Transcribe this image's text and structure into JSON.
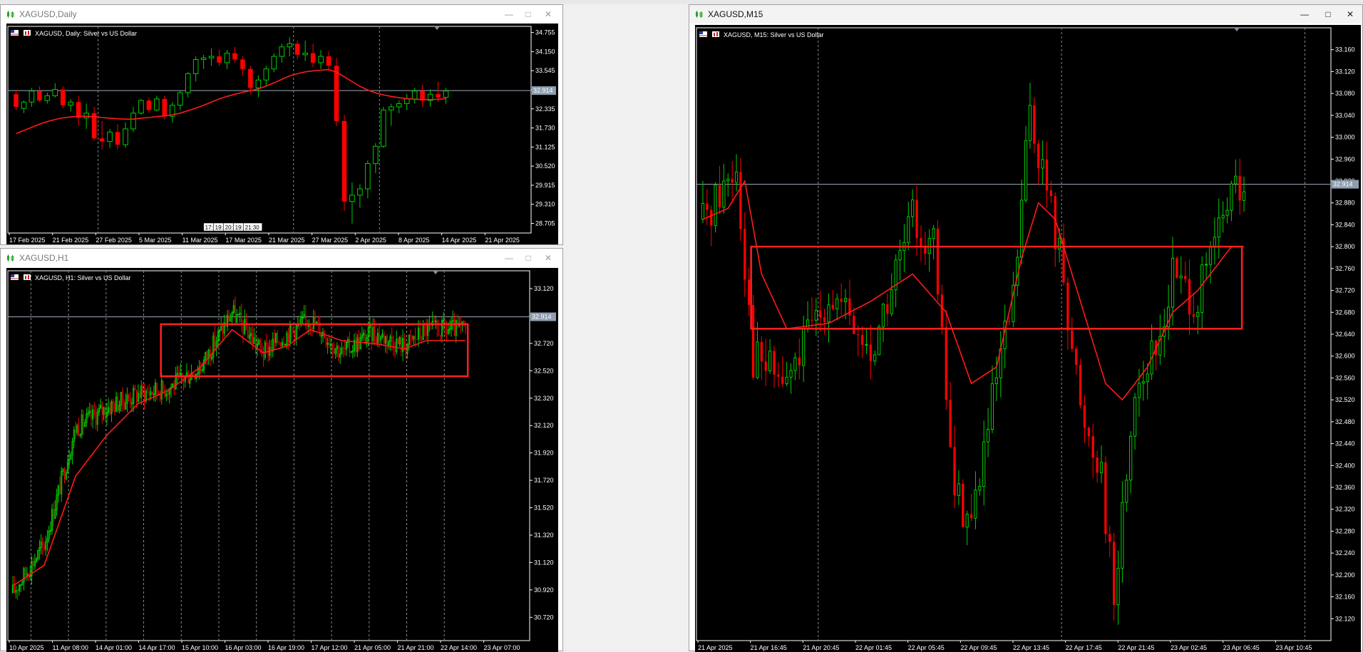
{
  "colors": {
    "bull": "#00cc00",
    "bear": "#ff0000",
    "ma": "#ff1a1a",
    "box": "#ff2020",
    "grid": "#8a8a8a",
    "axis": "#ffffff",
    "text": "#ffffff",
    "bid_line": "#a0a8b8",
    "bid_bg": "#8e9eb0",
    "label_bg": "#ffffff",
    "label_text": "#000000"
  },
  "icons": {
    "window": "candles-window-icon",
    "flag": "us-flag-icon",
    "chart": "candlestick-chart-icon",
    "minimize": "minimize-icon",
    "maximize": "maximize-icon",
    "close": "close-icon"
  },
  "windows": [
    {
      "id": "daily",
      "title": "XAGUSD,Daily",
      "header": "XAGUSD, Daily:  Silver vs US Dollar",
      "current_price": "32.914",
      "current_value": 32.914,
      "chart_data": {
        "type": "candlestick",
        "symbol": "XAGUSD",
        "timeframe": "Daily",
        "ylim": [
          28.4,
          34.95
        ],
        "y_ticks": [
          "34.755",
          "34.150",
          "33.545",
          "32.940",
          "32.335",
          "31.730",
          "31.125",
          "30.520",
          "29.915",
          "29.310",
          "28.705"
        ],
        "x_labels": [
          "17 Feb 2025",
          "21 Feb 2025",
          "27 Feb 2025",
          "5 Mar 2025",
          "11 Mar 2025",
          "17 Mar 2025",
          "21 Mar 2025",
          "27 Mar 2025",
          "2 Apr 2025",
          "8 Apr 2025",
          "14 Apr 2025",
          "21 Apr 2025"
        ],
        "x_dividers": [
          11,
          36,
          47
        ],
        "ohlc": [
          [
            32.8,
            32.95,
            32.3,
            32.4
          ],
          [
            32.35,
            32.6,
            32.2,
            32.55
          ],
          [
            32.55,
            33.0,
            32.4,
            32.9
          ],
          [
            32.9,
            33.05,
            32.55,
            32.6
          ],
          [
            32.6,
            32.85,
            32.5,
            32.75
          ],
          [
            32.75,
            33.15,
            32.7,
            32.95
          ],
          [
            32.95,
            33.05,
            32.35,
            32.45
          ],
          [
            32.45,
            32.65,
            32.25,
            32.55
          ],
          [
            32.55,
            32.75,
            31.8,
            32.05
          ],
          [
            32.05,
            32.5,
            31.7,
            32.2
          ],
          [
            32.2,
            32.4,
            31.35,
            31.4
          ],
          [
            31.4,
            31.95,
            31.05,
            31.3
          ],
          [
            31.3,
            31.7,
            31.1,
            31.6
          ],
          [
            31.6,
            31.85,
            31.05,
            31.2
          ],
          [
            31.2,
            31.9,
            31.1,
            31.7
          ],
          [
            31.7,
            32.4,
            31.6,
            32.2
          ],
          [
            32.2,
            32.65,
            32.15,
            32.6
          ],
          [
            32.6,
            32.7,
            32.2,
            32.3
          ],
          [
            32.3,
            32.75,
            32.25,
            32.65
          ],
          [
            32.65,
            32.75,
            32.0,
            32.1
          ],
          [
            32.1,
            32.55,
            31.9,
            32.45
          ],
          [
            32.45,
            32.9,
            32.3,
            32.85
          ],
          [
            32.85,
            33.5,
            32.7,
            33.45
          ],
          [
            33.45,
            34.0,
            33.2,
            33.9
          ],
          [
            33.9,
            34.05,
            33.6,
            33.95
          ],
          [
            33.95,
            34.25,
            33.7,
            34.0
          ],
          [
            34.0,
            34.2,
            33.7,
            33.8
          ],
          [
            33.8,
            34.2,
            33.6,
            34.1
          ],
          [
            34.1,
            34.3,
            33.8,
            33.9
          ],
          [
            33.9,
            34.0,
            33.4,
            33.6
          ],
          [
            33.6,
            33.7,
            32.8,
            33.0
          ],
          [
            33.0,
            33.4,
            32.7,
            33.25
          ],
          [
            33.25,
            33.7,
            33.05,
            33.6
          ],
          [
            33.6,
            34.1,
            33.5,
            34.0
          ],
          [
            34.0,
            34.4,
            33.8,
            34.3
          ],
          [
            34.3,
            34.6,
            34.0,
            34.4
          ],
          [
            34.4,
            34.5,
            33.9,
            34.05
          ],
          [
            34.05,
            34.5,
            33.85,
            34.1
          ],
          [
            34.1,
            34.4,
            33.65,
            33.8
          ],
          [
            33.8,
            34.2,
            33.6,
            34.0
          ],
          [
            34.0,
            34.15,
            33.55,
            33.7
          ],
          [
            33.7,
            33.95,
            31.8,
            31.95
          ],
          [
            31.95,
            32.15,
            29.1,
            29.4
          ],
          [
            29.4,
            30.0,
            28.7,
            29.6
          ],
          [
            29.6,
            29.95,
            29.2,
            29.8
          ],
          [
            29.8,
            30.7,
            29.5,
            30.6
          ],
          [
            30.6,
            31.25,
            30.3,
            31.15
          ],
          [
            31.15,
            32.4,
            31.1,
            32.3
          ],
          [
            32.3,
            32.5,
            31.8,
            32.4
          ],
          [
            32.4,
            32.6,
            32.2,
            32.5
          ],
          [
            32.5,
            32.8,
            32.3,
            32.65
          ],
          [
            32.65,
            33.0,
            32.5,
            32.9
          ],
          [
            32.9,
            33.1,
            32.4,
            32.6
          ],
          [
            32.6,
            32.95,
            32.4,
            32.8
          ],
          [
            32.8,
            33.2,
            32.55,
            32.7
          ],
          [
            32.7,
            33.0,
            32.5,
            32.9
          ]
        ],
        "ma": [
          31.55,
          31.65,
          31.75,
          31.85,
          31.93,
          32.0,
          32.05,
          32.08,
          32.1,
          32.1,
          32.09,
          32.06,
          32.04,
          32.02,
          32.01,
          32.01,
          32.04,
          32.06,
          32.09,
          32.11,
          32.15,
          32.2,
          32.28,
          32.36,
          32.45,
          32.55,
          32.65,
          32.73,
          32.8,
          32.86,
          32.91,
          32.97,
          33.06,
          33.16,
          33.27,
          33.38,
          33.45,
          33.51,
          33.54,
          33.56,
          33.58,
          33.5,
          33.35,
          33.2,
          33.05,
          32.93,
          32.84,
          32.78,
          32.73,
          32.69,
          32.66,
          32.64,
          32.63,
          32.63,
          32.64,
          32.66
        ],
        "overlay_labels": [
          "17:",
          "19:",
          "20:",
          "19:",
          "21:30"
        ]
      }
    },
    {
      "id": "h1",
      "title": "XAGUSD,H1",
      "header": "XAGUSD, H1:  Silver vs US Dollar",
      "current_price": "32.914",
      "current_value": 32.914,
      "chart_data": {
        "type": "candlestick",
        "symbol": "XAGUSD",
        "timeframe": "H1",
        "ylim": [
          30.55,
          33.25
        ],
        "y_ticks": [
          "33.120",
          "32.920",
          "32.720",
          "32.520",
          "32.320",
          "32.120",
          "31.920",
          "31.720",
          "31.520",
          "31.320",
          "31.120",
          "30.920",
          "30.720"
        ],
        "x_labels": [
          "10 Apr 2025",
          "11 Apr 08:00",
          "14 Apr 01:00",
          "14 Apr 17:00",
          "15 Apr 10:00",
          "16 Apr 03:00",
          "16 Apr 19:00",
          "17 Apr 12:00",
          "21 Apr 05:00",
          "21 Apr 21:00",
          "22 Apr 14:00",
          "23 Apr 07:00"
        ],
        "x_dividers": [
          12,
          36,
          60,
          84,
          108,
          132,
          156,
          180,
          204,
          228,
          252,
          276
        ],
        "trend_points": [
          [
            0,
            30.9
          ],
          [
            20,
            31.25
          ],
          [
            40,
            32.1
          ],
          [
            60,
            32.25
          ],
          [
            80,
            32.35
          ],
          [
            100,
            32.4
          ],
          [
            120,
            32.55
          ],
          [
            140,
            32.95
          ],
          [
            160,
            32.65
          ],
          [
            170,
            32.75
          ],
          [
            190,
            32.9
          ],
          [
            210,
            32.65
          ],
          [
            230,
            32.8
          ],
          [
            250,
            32.7
          ],
          [
            264,
            32.82
          ]
        ],
        "ma_points": [
          [
            0,
            30.95
          ],
          [
            20,
            31.1
          ],
          [
            40,
            31.75
          ],
          [
            60,
            32.05
          ],
          [
            80,
            32.28
          ],
          [
            100,
            32.38
          ],
          [
            120,
            32.55
          ],
          [
            140,
            32.82
          ],
          [
            160,
            32.65
          ],
          [
            175,
            32.7
          ],
          [
            190,
            32.82
          ],
          [
            210,
            32.74
          ],
          [
            230,
            32.72
          ],
          [
            250,
            32.68
          ],
          [
            264,
            32.74
          ]
        ],
        "box": {
          "x0": 95,
          "x1": 290,
          "y0": 32.48,
          "y1": 32.86
        }
      }
    },
    {
      "id": "m15",
      "title": "XAGUSD,M15",
      "header": "XAGUSD, M15:  Silver vs US Dollar",
      "current_price": "32.914",
      "current_value": 32.914,
      "chart_data": {
        "type": "candlestick",
        "symbol": "XAGUSD",
        "timeframe": "M15",
        "ylim": [
          32.08,
          33.2
        ],
        "y_ticks": [
          "33.160",
          "33.120",
          "33.080",
          "33.040",
          "33.000",
          "32.960",
          "32.920",
          "32.880",
          "32.840",
          "32.800",
          "32.760",
          "32.720",
          "32.680",
          "32.640",
          "32.600",
          "32.560",
          "32.520",
          "32.480",
          "32.440",
          "32.400",
          "32.360",
          "32.320",
          "32.280",
          "32.240",
          "32.200",
          "32.160",
          "32.120"
        ],
        "x_labels": [
          "21 Apr 2025",
          "21 Apr 16:45",
          "21 Apr 20:45",
          "22 Apr 01:45",
          "22 Apr 05:45",
          "22 Apr 09:45",
          "22 Apr 13:45",
          "22 Apr 17:45",
          "22 Apr 21:45",
          "23 Apr 02:45",
          "23 Apr 06:45",
          "23 Apr 10:45"
        ],
        "x_dividers": [
          28,
          86,
          144
        ],
        "trend_points": [
          [
            0,
            32.85
          ],
          [
            8,
            32.95
          ],
          [
            12,
            32.6
          ],
          [
            20,
            32.55
          ],
          [
            30,
            32.72
          ],
          [
            40,
            32.6
          ],
          [
            50,
            32.85
          ],
          [
            55,
            32.8
          ],
          [
            60,
            32.35
          ],
          [
            64,
            32.3
          ],
          [
            70,
            32.55
          ],
          [
            74,
            32.7
          ],
          [
            78,
            33.05
          ],
          [
            82,
            32.9
          ],
          [
            86,
            32.75
          ],
          [
            90,
            32.5
          ],
          [
            95,
            32.4
          ],
          [
            98,
            32.15
          ],
          [
            103,
            32.55
          ],
          [
            108,
            32.6
          ],
          [
            112,
            32.75
          ],
          [
            118,
            32.7
          ],
          [
            124,
            32.85
          ],
          [
            126,
            32.9
          ]
        ],
        "ma_points": [
          [
            0,
            32.85
          ],
          [
            6,
            32.87
          ],
          [
            10,
            32.92
          ],
          [
            14,
            32.75
          ],
          [
            20,
            32.65
          ],
          [
            30,
            32.66
          ],
          [
            40,
            32.7
          ],
          [
            50,
            32.75
          ],
          [
            58,
            32.68
          ],
          [
            64,
            32.55
          ],
          [
            70,
            32.58
          ],
          [
            76,
            32.78
          ],
          [
            80,
            32.88
          ],
          [
            84,
            32.85
          ],
          [
            90,
            32.7
          ],
          [
            96,
            32.55
          ],
          [
            100,
            32.52
          ],
          [
            106,
            32.58
          ],
          [
            112,
            32.68
          ],
          [
            118,
            32.72
          ],
          [
            126,
            32.8
          ]
        ],
        "box": {
          "x0": 12,
          "x1": 128,
          "y0": 32.65,
          "y1": 32.8
        }
      }
    }
  ]
}
